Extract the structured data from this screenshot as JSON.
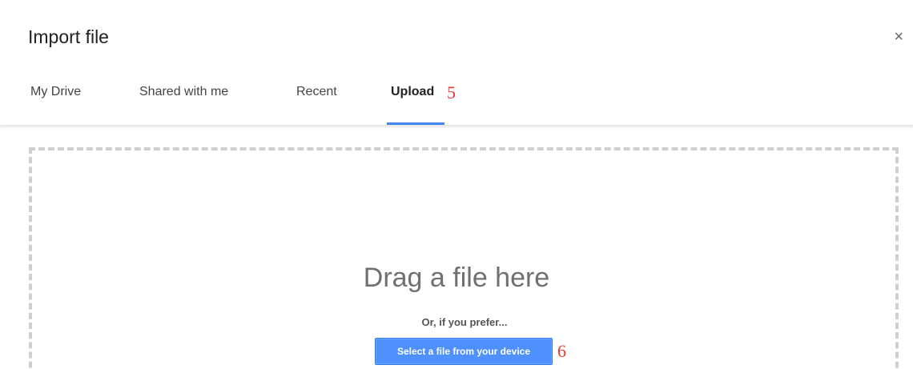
{
  "dialog": {
    "title": "Import file",
    "close_symbol": "×"
  },
  "tabs": [
    {
      "label": "My Drive",
      "active": false
    },
    {
      "label": "Shared with me",
      "active": false
    },
    {
      "label": "Recent",
      "active": false
    },
    {
      "label": "Upload",
      "active": true
    }
  ],
  "annotations": {
    "upload_tab_marker": "5",
    "select_button_marker": "6"
  },
  "upload": {
    "drag_text": "Drag a file here",
    "prefer_text": "Or, if you prefer...",
    "select_button_label": "Select a file from your device"
  },
  "colors": {
    "accent": "#4285f4",
    "button": "#4d90fe",
    "annotation": "#e8372c",
    "dropzone_border": "#cfcfcf"
  },
  "icons": {
    "close": "close-icon"
  }
}
